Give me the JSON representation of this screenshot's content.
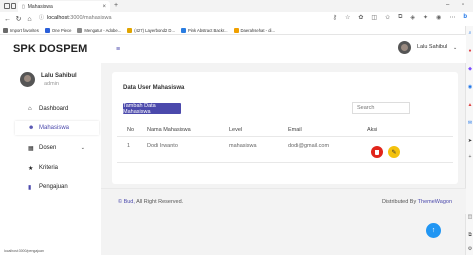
{
  "browser": {
    "tab_title": "Mahasiswa",
    "url_host": "localhost",
    "url_rest": ":3000/mahasiswa",
    "favorites": [
      {
        "label": "Import favorites",
        "color": "#6b6b6b"
      },
      {
        "label": "One Piece",
        "color": "#2b5fd9"
      },
      {
        "label": "Mengatur - Adobe...",
        "color": "#888888"
      },
      {
        "label": "(427) Layerbond2 D...",
        "color": "#e0a400"
      },
      {
        "label": "Pink Abstract Backr...",
        "color": "#2a7de1"
      },
      {
        "label": "Daerahsehat - di...",
        "color": "#f0a000"
      }
    ],
    "status_url": "localhost:3000/pengajuan"
  },
  "sidebar": {
    "brand": "SPK DOSPEM",
    "user_name": "Lalu Sahibul",
    "user_role": "admin",
    "items": [
      {
        "label": "Dashboard",
        "icon": "home-icon",
        "glyph": "⌂",
        "color": "#222222"
      },
      {
        "label": "Mahasiswa",
        "icon": "users-icon",
        "glyph": "☻",
        "color": "#4b49ac"
      },
      {
        "label": "Dosen",
        "icon": "grid-icon",
        "glyph": "▦",
        "color": "#222222"
      },
      {
        "label": "Kriteria",
        "icon": "star-icon",
        "glyph": "★",
        "color": "#222222"
      },
      {
        "label": "Pengajuan",
        "icon": "file-icon",
        "glyph": "▮",
        "color": "#4b49ac"
      }
    ]
  },
  "topbar": {
    "user_name": "Lalu Sahibul"
  },
  "main": {
    "card_title": "Data User Mahasiswa",
    "add_button": "Tambah Data Mahasiswa",
    "search_placeholder": "Search",
    "columns": [
      "No",
      "Nama Mahasiswa",
      "Level",
      "Email",
      "Aksi"
    ],
    "rows": [
      {
        "no": "1",
        "nama": "Dodi Irwanto",
        "level": "mahasiswa",
        "email": "dodi@gmail.com"
      }
    ]
  },
  "footer": {
    "copyright_link": "© Bud,",
    "copyright_text": " All Right Reserved.",
    "distributed_text": "Distributed By ",
    "distributed_link": "ThemeWagon"
  },
  "colors": {
    "accent": "#4b49ac",
    "delete": "#e1251b",
    "edit": "#f4c20d",
    "scroll_top": "#2196f3"
  }
}
